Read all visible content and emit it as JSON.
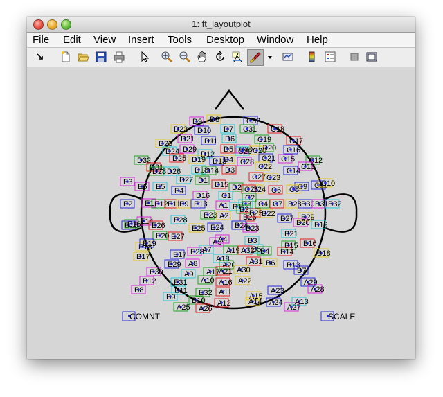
{
  "window": {
    "title": "1: ft_layoutplot"
  },
  "menu": [
    "File",
    "Edit",
    "View",
    "Insert",
    "Tools",
    "Desktop",
    "Window",
    "Help"
  ],
  "toolbar": {
    "icons": [
      "dock-arrow-icon",
      "new-figure-icon",
      "open-file-icon",
      "save-icon",
      "print-icon",
      "pointer-icon",
      "zoom-in-icon",
      "zoom-out-icon",
      "pan-hand-icon",
      "rotate-3d-icon",
      "data-cursor-icon",
      "brush-icon",
      "dropdown-arrow-icon",
      "link-plot-icon",
      "colorbar-icon",
      "legend-icon",
      "hide-plot-tools-icon",
      "show-plot-tools-icon"
    ]
  },
  "layout": {
    "outline_color": "#000000",
    "box_colors": [
      "#e6c828",
      "#2a2ad8",
      "#d82ad8",
      "#28c8d8",
      "#20a020",
      "#e02020"
    ],
    "special": [
      {
        "label": "COMNT",
        "box_color": "#2a2ad8"
      },
      {
        "label": "SCALE",
        "box_color": "#2a2ad8"
      }
    ],
    "channels": [
      "D8",
      "C32",
      "D9",
      "D7",
      "C31",
      "C18",
      "D22",
      "D10",
      "D21",
      "D6",
      "C19",
      "C17",
      "D23",
      "D11",
      "C30",
      "D24",
      "D20",
      "D5",
      "C20",
      "C16",
      "D29",
      "C29",
      "D32",
      "D25",
      "D4",
      "C21",
      "C15",
      "D12",
      "C12",
      "D31",
      "D19",
      "D13",
      "C28",
      "D26",
      "D28",
      "D3",
      "C22",
      "C14",
      "C13",
      "D18",
      "D14",
      "C27",
      "C23",
      "C11",
      "E3",
      "D27",
      "D1",
      "D15",
      "C24",
      "C9",
      "E6",
      "E5",
      "D2",
      "C25",
      "C8",
      "E4",
      "D16",
      "C1",
      "C2",
      "C6",
      "C10",
      "E2",
      "E1",
      "C3",
      "C4",
      "C7",
      "B28",
      "B30",
      "B31",
      "B32",
      "E12",
      "E11",
      "E9",
      "E13",
      "A1",
      "B1",
      "B2",
      "B26",
      "B29",
      "E15",
      "E14",
      "E28",
      "E23",
      "B25",
      "B22",
      "B27",
      "B20",
      "B19",
      "E16",
      "E26",
      "A2",
      "B24",
      "B23",
      "B21",
      "E20",
      "E27",
      "E25",
      "E24",
      "A3",
      "B3",
      "B15",
      "B16",
      "E18",
      "E19",
      "A4",
      "B5",
      "B4",
      "B14",
      "B17",
      "E17",
      "E28b",
      "A7",
      "A19",
      "A32",
      "B18",
      "E29",
      "A8",
      "A18",
      "A20",
      "A31",
      "B6",
      "B13",
      "E30",
      "A9",
      "A17",
      "A21",
      "A30",
      "B7",
      "B12",
      "E31",
      "A10",
      "A16",
      "A22",
      "A29",
      "B8",
      "B11",
      "E32",
      "A11",
      "A15",
      "A23",
      "A28",
      "B9",
      "B10",
      "A12",
      "A14",
      "A24",
      "A27",
      "A13",
      "A25",
      "A26"
    ]
  }
}
